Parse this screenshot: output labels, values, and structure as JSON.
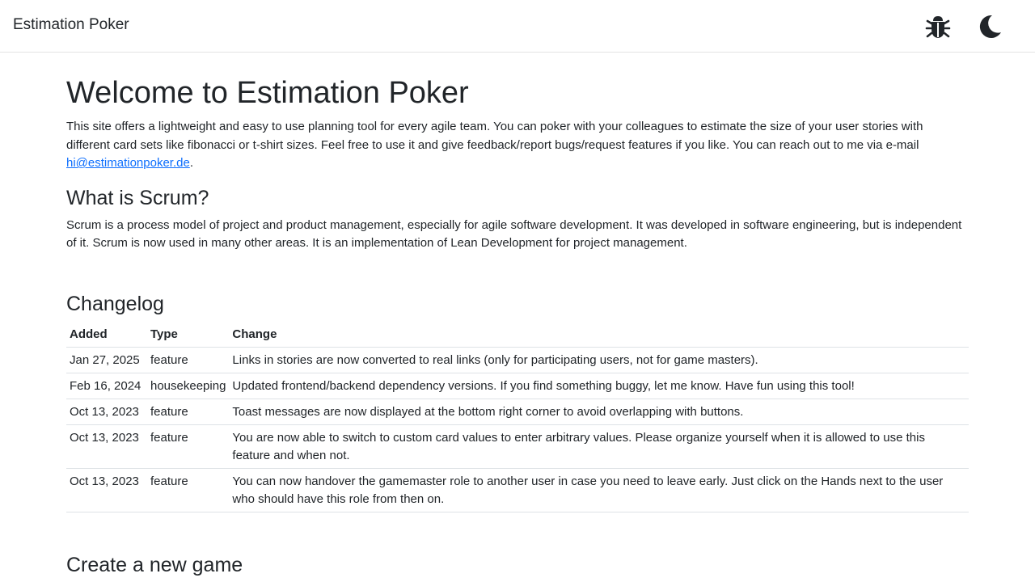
{
  "navbar": {
    "brand": "Estimation Poker",
    "icons": [
      "bug-icon",
      "moon-icon"
    ]
  },
  "welcome": {
    "title": "Welcome to Estimation Poker",
    "intro_text": "This site offers a lightweight and easy to use planning tool for every agile team. You can poker with your colleagues to estimate the size of your user stories with different card sets like fibonacci or t-shirt sizes. Feel free to use it and give feedback/report bugs/request features if you like. You can reach out to me via e-mail ",
    "email": "hi@estimationpoker.de",
    "intro_end": "."
  },
  "scrum": {
    "title": "What is Scrum?",
    "text": "Scrum is a process model of project and product management, especially for agile software development. It was developed in software engineering, but is independent of it. Scrum is now used in many other areas. It is an implementation of Lean Development for project management."
  },
  "changelog": {
    "title": "Changelog",
    "headers": {
      "added": "Added",
      "type": "Type",
      "change": "Change"
    },
    "rows": [
      {
        "added": "Jan 27, 2025",
        "type": "feature",
        "change": "Links in stories are now converted to real links (only for participating users, not for game masters)."
      },
      {
        "added": "Feb 16, 2024",
        "type": "housekeeping",
        "change": "Updated frontend/backend dependency versions. If you find something buggy, let me know. Have fun using this tool!"
      },
      {
        "added": "Oct 13, 2023",
        "type": "feature",
        "change": "Toast messages are now displayed at the bottom right corner to avoid overlapping with buttons."
      },
      {
        "added": "Oct 13, 2023",
        "type": "feature",
        "change": "You are now able to switch to custom card values to enter arbitrary values. Please organize yourself when it is allowed to use this feature and when not."
      },
      {
        "added": "Oct 13, 2023",
        "type": "feature",
        "change": "You can now handover the gamemaster role to another user in case you need to leave early. Just click on the Hands next to the user who should have this role from then on."
      }
    ]
  },
  "create": {
    "title": "Create a new game"
  }
}
